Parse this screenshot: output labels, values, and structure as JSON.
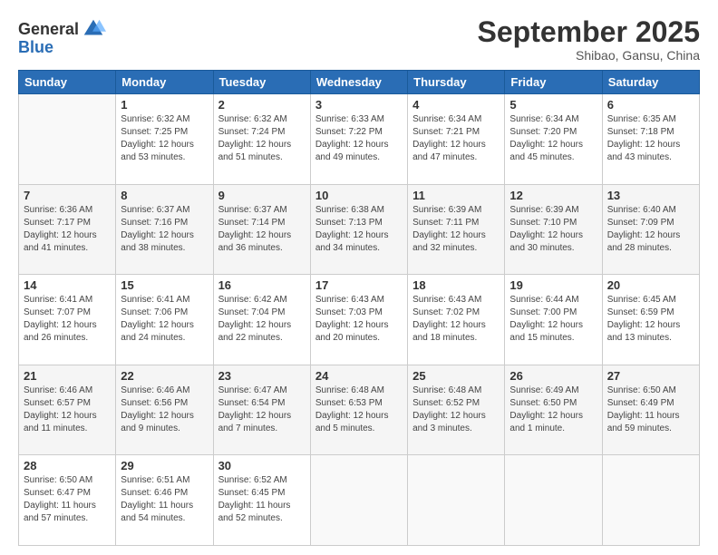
{
  "header": {
    "logo_line1": "General",
    "logo_line2": "Blue",
    "month_title": "September 2025",
    "location": "Shibao, Gansu, China"
  },
  "days_of_week": [
    "Sunday",
    "Monday",
    "Tuesday",
    "Wednesday",
    "Thursday",
    "Friday",
    "Saturday"
  ],
  "weeks": [
    [
      {
        "day": "",
        "info": ""
      },
      {
        "day": "1",
        "info": "Sunrise: 6:32 AM\nSunset: 7:25 PM\nDaylight: 12 hours\nand 53 minutes."
      },
      {
        "day": "2",
        "info": "Sunrise: 6:32 AM\nSunset: 7:24 PM\nDaylight: 12 hours\nand 51 minutes."
      },
      {
        "day": "3",
        "info": "Sunrise: 6:33 AM\nSunset: 7:22 PM\nDaylight: 12 hours\nand 49 minutes."
      },
      {
        "day": "4",
        "info": "Sunrise: 6:34 AM\nSunset: 7:21 PM\nDaylight: 12 hours\nand 47 minutes."
      },
      {
        "day": "5",
        "info": "Sunrise: 6:34 AM\nSunset: 7:20 PM\nDaylight: 12 hours\nand 45 minutes."
      },
      {
        "day": "6",
        "info": "Sunrise: 6:35 AM\nSunset: 7:18 PM\nDaylight: 12 hours\nand 43 minutes."
      }
    ],
    [
      {
        "day": "7",
        "info": "Sunrise: 6:36 AM\nSunset: 7:17 PM\nDaylight: 12 hours\nand 41 minutes."
      },
      {
        "day": "8",
        "info": "Sunrise: 6:37 AM\nSunset: 7:16 PM\nDaylight: 12 hours\nand 38 minutes."
      },
      {
        "day": "9",
        "info": "Sunrise: 6:37 AM\nSunset: 7:14 PM\nDaylight: 12 hours\nand 36 minutes."
      },
      {
        "day": "10",
        "info": "Sunrise: 6:38 AM\nSunset: 7:13 PM\nDaylight: 12 hours\nand 34 minutes."
      },
      {
        "day": "11",
        "info": "Sunrise: 6:39 AM\nSunset: 7:11 PM\nDaylight: 12 hours\nand 32 minutes."
      },
      {
        "day": "12",
        "info": "Sunrise: 6:39 AM\nSunset: 7:10 PM\nDaylight: 12 hours\nand 30 minutes."
      },
      {
        "day": "13",
        "info": "Sunrise: 6:40 AM\nSunset: 7:09 PM\nDaylight: 12 hours\nand 28 minutes."
      }
    ],
    [
      {
        "day": "14",
        "info": "Sunrise: 6:41 AM\nSunset: 7:07 PM\nDaylight: 12 hours\nand 26 minutes."
      },
      {
        "day": "15",
        "info": "Sunrise: 6:41 AM\nSunset: 7:06 PM\nDaylight: 12 hours\nand 24 minutes."
      },
      {
        "day": "16",
        "info": "Sunrise: 6:42 AM\nSunset: 7:04 PM\nDaylight: 12 hours\nand 22 minutes."
      },
      {
        "day": "17",
        "info": "Sunrise: 6:43 AM\nSunset: 7:03 PM\nDaylight: 12 hours\nand 20 minutes."
      },
      {
        "day": "18",
        "info": "Sunrise: 6:43 AM\nSunset: 7:02 PM\nDaylight: 12 hours\nand 18 minutes."
      },
      {
        "day": "19",
        "info": "Sunrise: 6:44 AM\nSunset: 7:00 PM\nDaylight: 12 hours\nand 15 minutes."
      },
      {
        "day": "20",
        "info": "Sunrise: 6:45 AM\nSunset: 6:59 PM\nDaylight: 12 hours\nand 13 minutes."
      }
    ],
    [
      {
        "day": "21",
        "info": "Sunrise: 6:46 AM\nSunset: 6:57 PM\nDaylight: 12 hours\nand 11 minutes."
      },
      {
        "day": "22",
        "info": "Sunrise: 6:46 AM\nSunset: 6:56 PM\nDaylight: 12 hours\nand 9 minutes."
      },
      {
        "day": "23",
        "info": "Sunrise: 6:47 AM\nSunset: 6:54 PM\nDaylight: 12 hours\nand 7 minutes."
      },
      {
        "day": "24",
        "info": "Sunrise: 6:48 AM\nSunset: 6:53 PM\nDaylight: 12 hours\nand 5 minutes."
      },
      {
        "day": "25",
        "info": "Sunrise: 6:48 AM\nSunset: 6:52 PM\nDaylight: 12 hours\nand 3 minutes."
      },
      {
        "day": "26",
        "info": "Sunrise: 6:49 AM\nSunset: 6:50 PM\nDaylight: 12 hours\nand 1 minute."
      },
      {
        "day": "27",
        "info": "Sunrise: 6:50 AM\nSunset: 6:49 PM\nDaylight: 11 hours\nand 59 minutes."
      }
    ],
    [
      {
        "day": "28",
        "info": "Sunrise: 6:50 AM\nSunset: 6:47 PM\nDaylight: 11 hours\nand 57 minutes."
      },
      {
        "day": "29",
        "info": "Sunrise: 6:51 AM\nSunset: 6:46 PM\nDaylight: 11 hours\nand 54 minutes."
      },
      {
        "day": "30",
        "info": "Sunrise: 6:52 AM\nSunset: 6:45 PM\nDaylight: 11 hours\nand 52 minutes."
      },
      {
        "day": "",
        "info": ""
      },
      {
        "day": "",
        "info": ""
      },
      {
        "day": "",
        "info": ""
      },
      {
        "day": "",
        "info": ""
      }
    ]
  ]
}
